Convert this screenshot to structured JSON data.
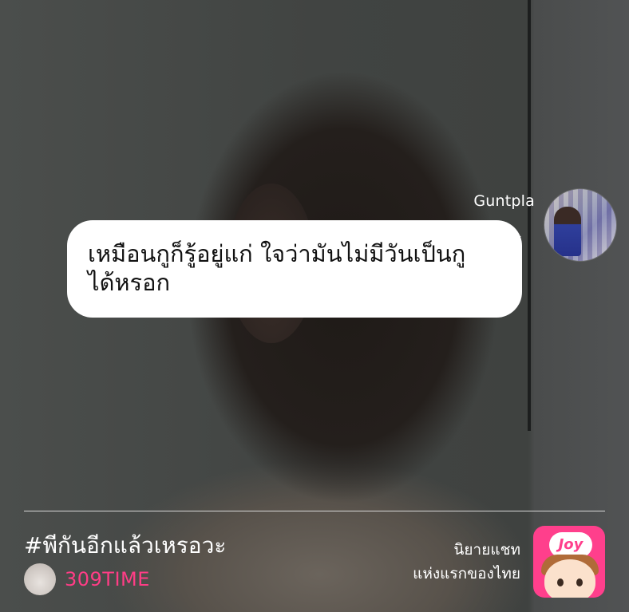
{
  "message": {
    "sender": "Guntpla",
    "text": "เหมือนกูก็รู้อยู่แก่ ใจว่ามันไม่มีวันเป็นกู\nได้หรอก"
  },
  "story": {
    "hashtag": "#พีกันอีกแล้วเหรอวะ",
    "author": "309TIME"
  },
  "brand": {
    "tagline_line1": "นิยายแชท",
    "tagline_line2": "แห่งแรกของไทย",
    "logo_text": "Joy"
  },
  "colors": {
    "accent": "#ff3d86",
    "bubble": "#ffffff"
  }
}
